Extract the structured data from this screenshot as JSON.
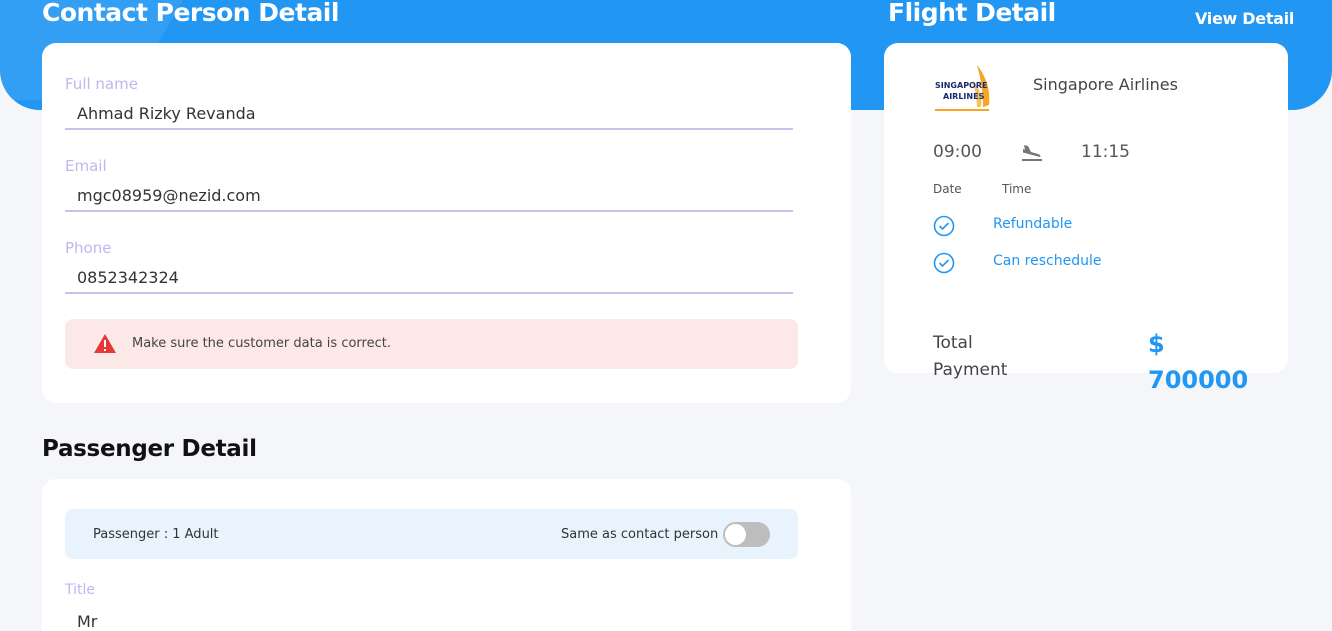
{
  "header": {
    "contact_title": "Contact Person Detail",
    "flight_title": "Flight Detail",
    "view_detail_label": "View Detail"
  },
  "contact": {
    "full_name": {
      "label": "Full name",
      "value": "Ahmad Rizky Revanda"
    },
    "email": {
      "label": "Email",
      "value": "mgc08959@nezid.com"
    },
    "phone": {
      "label": "Phone",
      "value": "0852342324"
    },
    "warning": "Make sure the customer data is correct."
  },
  "passenger": {
    "section_title": "Passenger Detail",
    "count_label": "Passenger : 1 Adult",
    "same_as_contact_label": "Same as contact person",
    "same_as_contact_on": false,
    "title_field": {
      "label": "Title",
      "value": "Mr"
    }
  },
  "flight": {
    "airline_logo_text": [
      "SINGAPORE",
      "AIRLINES"
    ],
    "airline_name": "Singapore Airlines",
    "departure_time": "09:00",
    "arrival_time": "11:15",
    "date_label": "Date",
    "time_label": "Time",
    "features": [
      "Refundable",
      "Can reschedule"
    ],
    "total_label": "Total Payment",
    "total_amount": "$ 700000"
  },
  "colors": {
    "primary": "#2196f3",
    "label_purple": "#c5b4f0",
    "warning_bg": "#fde8e8",
    "warning_icon": "#e53935",
    "logo_gold": "#f5a623",
    "logo_navy": "#1a2a6c"
  }
}
